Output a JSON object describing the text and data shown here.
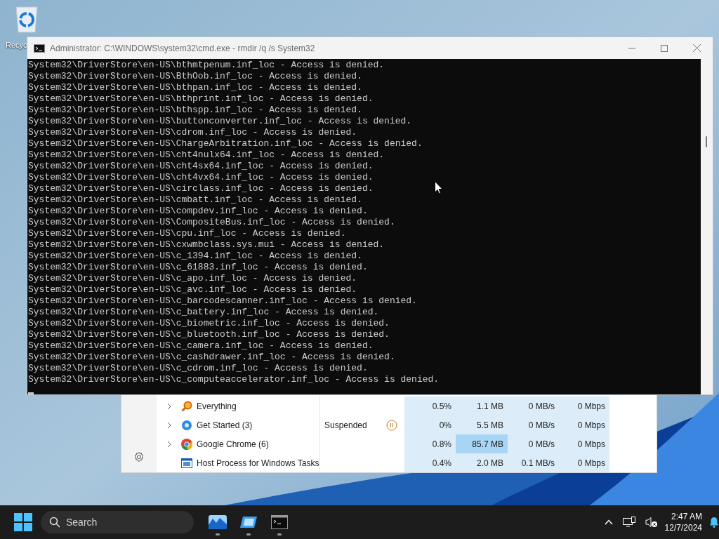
{
  "desktop": {
    "icons": [
      {
        "label": "Recyc"
      }
    ]
  },
  "console_window": {
    "title": "Administrator: C:\\WINDOWS\\system32\\cmd.exe - rmdir  /q /s System32",
    "lines": [
      "System32\\DriverStore\\en-US\\bthmtpenum.inf_loc - Access is denied.",
      "System32\\DriverStore\\en-US\\BthOob.inf_loc - Access is denied.",
      "System32\\DriverStore\\en-US\\bthpan.inf_loc - Access is denied.",
      "System32\\DriverStore\\en-US\\bthprint.inf_loc - Access is denied.",
      "System32\\DriverStore\\en-US\\bthspp.inf_loc - Access is denied.",
      "System32\\DriverStore\\en-US\\buttonconverter.inf_loc - Access is denied.",
      "System32\\DriverStore\\en-US\\cdrom.inf_loc - Access is denied.",
      "System32\\DriverStore\\en-US\\ChargeArbitration.inf_loc - Access is denied.",
      "System32\\DriverStore\\en-US\\cht4nulx64.inf_loc - Access is denied.",
      "System32\\DriverStore\\en-US\\cht4sx64.inf_loc - Access is denied.",
      "System32\\DriverStore\\en-US\\cht4vx64.inf_loc - Access is denied.",
      "System32\\DriverStore\\en-US\\circlass.inf_loc - Access is denied.",
      "System32\\DriverStore\\en-US\\cmbatt.inf_loc - Access is denied.",
      "System32\\DriverStore\\en-US\\compdev.inf_loc - Access is denied.",
      "System32\\DriverStore\\en-US\\CompositeBus.inf_loc - Access is denied.",
      "System32\\DriverStore\\en-US\\cpu.inf_loc - Access is denied.",
      "System32\\DriverStore\\en-US\\cxwmbclass.sys.mui - Access is denied.",
      "System32\\DriverStore\\en-US\\c_1394.inf_loc - Access is denied.",
      "System32\\DriverStore\\en-US\\c_61883.inf_loc - Access is denied.",
      "System32\\DriverStore\\en-US\\c_apo.inf_loc - Access is denied.",
      "System32\\DriverStore\\en-US\\c_avc.inf_loc - Access is denied.",
      "System32\\DriverStore\\en-US\\c_barcodescanner.inf_loc - Access is denied.",
      "System32\\DriverStore\\en-US\\c_battery.inf_loc - Access is denied.",
      "System32\\DriverStore\\en-US\\c_biometric.inf_loc - Access is denied.",
      "System32\\DriverStore\\en-US\\c_bluetooth.inf_loc - Access is denied.",
      "System32\\DriverStore\\en-US\\c_camera.inf_loc - Access is denied.",
      "System32\\DriverStore\\en-US\\c_cashdrawer.inf_loc - Access is denied.",
      "System32\\DriverStore\\en-US\\c_cdrom.inf_loc - Access is denied.",
      "System32\\DriverStore\\en-US\\c_computeaccelerator.inf_loc - Access is denied."
    ]
  },
  "task_manager": {
    "rows": [
      {
        "kind": "everything",
        "name": "Everything",
        "expandable": true,
        "status": null,
        "cpu": "0.5%",
        "memory": "1.1 MB",
        "memory_high": false,
        "disk": "0 MB/s",
        "network": "0 Mbps"
      },
      {
        "kind": "get-started",
        "name": "Get Started (3)",
        "expandable": true,
        "status": "Suspended",
        "cpu": "0%",
        "memory": "5.5 MB",
        "memory_high": false,
        "disk": "0 MB/s",
        "network": "0 Mbps"
      },
      {
        "kind": "chrome",
        "name": "Google Chrome (6)",
        "expandable": true,
        "status": null,
        "cpu": "0.8%",
        "memory": "85.7 MB",
        "memory_high": true,
        "disk": "0 MB/s",
        "network": "0 Mbps"
      },
      {
        "kind": "host",
        "name": "Host Process for Windows Tasks",
        "expandable": false,
        "status": null,
        "cpu": "0.4%",
        "memory": "2.0 MB",
        "memory_high": false,
        "disk": "0.1 MB/s",
        "network": "0 Mbps"
      }
    ]
  },
  "taskbar": {
    "search": {
      "placeholder": "Search"
    },
    "apps": [
      {
        "kind": "photos",
        "running": true
      },
      {
        "kind": "explorer",
        "running": true
      },
      {
        "kind": "terminal",
        "running": true
      }
    ],
    "time": "2:47 AM",
    "date": "12/7/2024"
  }
}
